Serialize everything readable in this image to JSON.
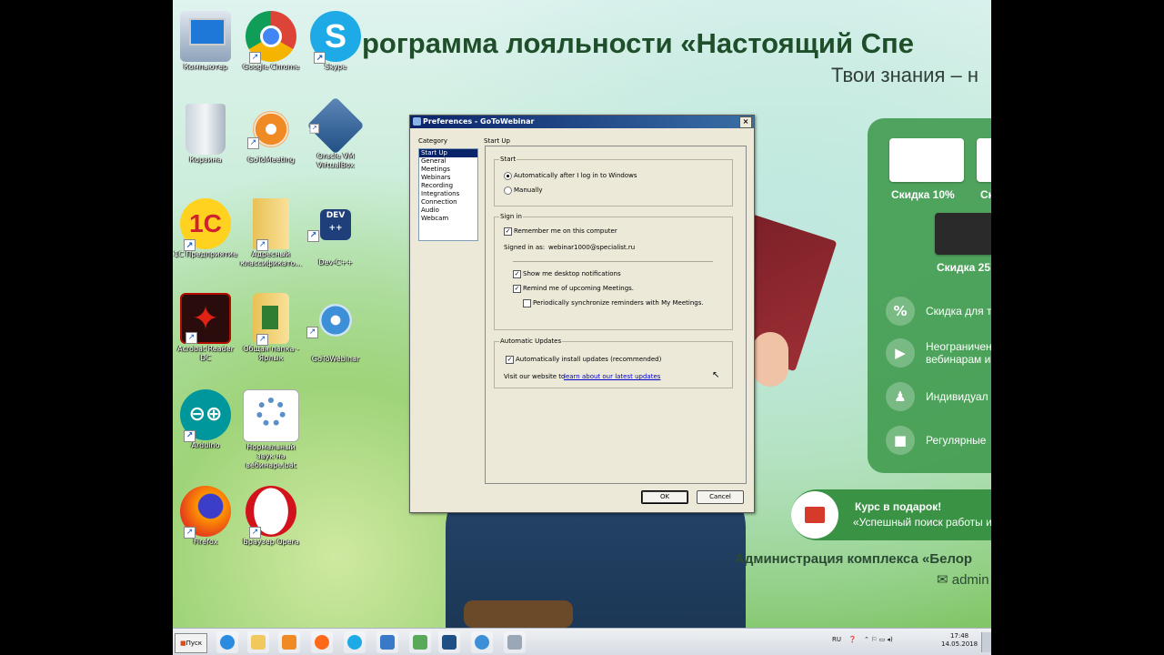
{
  "wallpaper": {
    "title": "рограмма лояльности  «Настоящий Спе",
    "subtitle": "Твои знания – н",
    "discounts": [
      "Скидка 10%",
      "Ск",
      "Скидка 25"
    ],
    "features": [
      "Скидка для т",
      "Неограничен",
      "вебинарам и",
      "Индивидуал",
      "Регулярные"
    ],
    "feature_icons": [
      "percent-icon",
      "play-icon",
      "people-icon",
      "gift-icon"
    ],
    "gift_title": "Курс в подарок!",
    "gift_sub": "«Успешный поиск работы и",
    "admin": "Администрация комплекса «Белор",
    "mail": "admin"
  },
  "desktop_icons": [
    {
      "label": "Компьютер",
      "name": "computer-icon"
    },
    {
      "label": "Google Chrome",
      "name": "chrome-icon"
    },
    {
      "label": "Skype",
      "name": "skype-icon"
    },
    {
      "label": "Корзина",
      "name": "recycle-bin-icon"
    },
    {
      "label": "GoToMeeting",
      "name": "gotomeeting-icon"
    },
    {
      "label": "Oracle VM VirtualBox",
      "name": "virtualbox-icon"
    },
    {
      "label": "1С Предприятие",
      "name": "1c-icon"
    },
    {
      "label": "Адресный классификато...",
      "name": "folder-icon"
    },
    {
      "label": "Dev-C++",
      "name": "devcpp-icon"
    },
    {
      "label": "Acrobat Reader DC",
      "name": "acrobat-icon"
    },
    {
      "label": "Общая папка - Ярлык",
      "name": "shared-folder-icon"
    },
    {
      "label": "GoToWebinar",
      "name": "gotowebinar-icon"
    },
    {
      "label": "Arduino",
      "name": "arduino-icon"
    },
    {
      "label": "Нормальный звук на вебинаре.bat",
      "name": "bat-file-icon"
    },
    {
      "label": "Firefox",
      "name": "firefox-icon"
    },
    {
      "label": "Браузер Opera",
      "name": "opera-icon"
    }
  ],
  "dialog": {
    "title": "Preferences - GoToWebinar",
    "close": "×",
    "category_label": "Category",
    "panel_title": "Start Up",
    "categories": [
      "Start Up",
      "General",
      "Meetings",
      "Webinars",
      "Recording",
      "Integrations",
      "Connection",
      "Audio",
      "Webcam"
    ],
    "start": {
      "legend": "Start",
      "opt_auto": "Automatically after I log in to Windows",
      "opt_manual": "Manually"
    },
    "signin": {
      "legend": "Sign in",
      "remember": "Remember me on this computer",
      "signed_in_label": "Signed in as:",
      "signed_in_value": "webinar1000@specialist.ru",
      "show_notifications": "Show me desktop notifications",
      "remind": "Remind me of upcoming Meetings.",
      "sync": "Periodically synchronize reminders with My Meetings."
    },
    "updates": {
      "legend": "Automatic Updates",
      "auto_install": "Automatically install updates (recommended)",
      "visit": "Visit our website to",
      "link": "learn about our latest updates"
    },
    "ok": "OK",
    "cancel": "Cancel"
  },
  "taskbar": {
    "start": "Пуск",
    "lang": "RU",
    "time": "17:48",
    "date": "14.05.2018"
  }
}
